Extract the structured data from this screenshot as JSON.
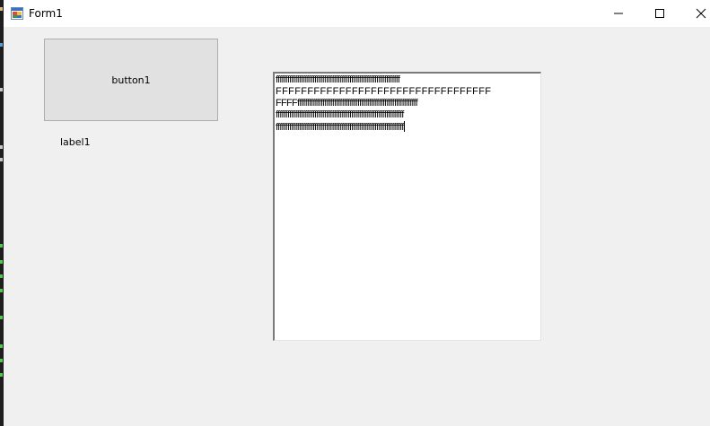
{
  "window": {
    "title": "Form1"
  },
  "form": {
    "button_label": "button1",
    "label_text": "label1",
    "textbox_lines": [
      "ffffffffffffffffffffffffffffffffffffffffffffffffffffffffffffffff",
      "FFFFFFFFFFFFFFFFFFFFFFFFFFFFFFFFFF",
      "FFFFffffffffffffffffffffffffffffffffffffffffffffffffffffffffffffff",
      "ffffffffffffffffffffffffffffffffffffffffffffffffffffffffffffffffff",
      "ffffffffffffffffffffffffffffffffffffffffffffffffffffffffffffffffff"
    ]
  },
  "icons": {
    "app": "form-app-icon",
    "minimize": "minimize-icon",
    "maximize": "maximize-icon",
    "close": "close-icon"
  },
  "colors": {
    "form_background": "#f0f0f0",
    "titlebar": "#ffffff",
    "button_face": "#e1e1e1",
    "button_border": "#adadad",
    "textbox_background": "#ffffff"
  }
}
